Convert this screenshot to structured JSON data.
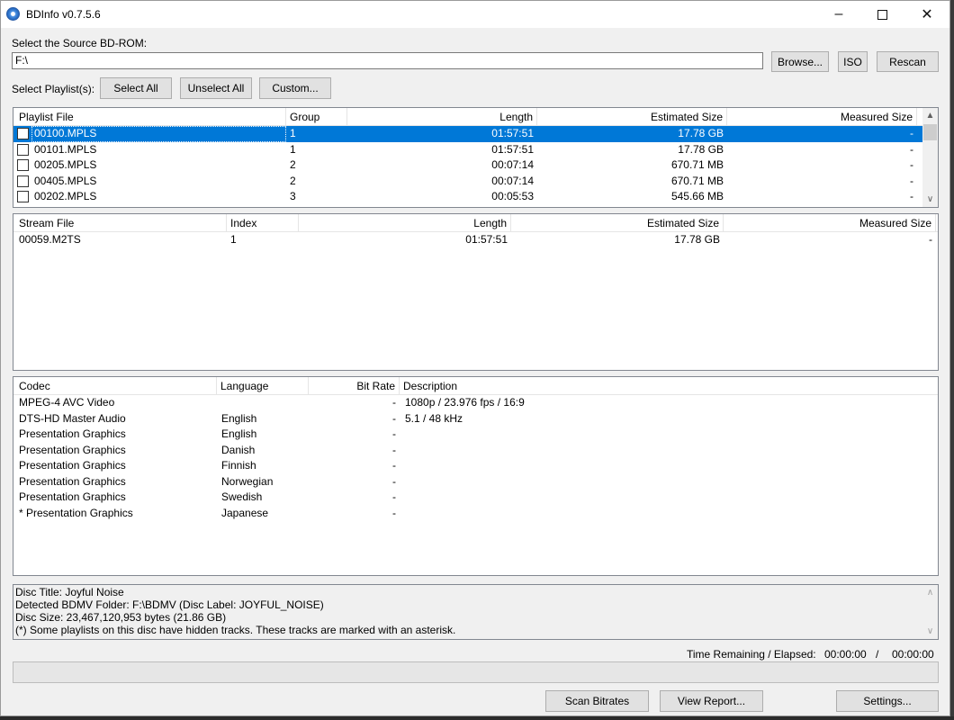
{
  "window": {
    "title": "BDInfo v0.7.5.6"
  },
  "source": {
    "label": "Select the Source BD-ROM:",
    "path": "F:\\",
    "browse_label": "Browse...",
    "iso_label": "ISO",
    "rescan_label": "Rescan"
  },
  "playlist_controls": {
    "label": "Select Playlist(s):",
    "select_all": "Select All",
    "unselect_all": "Unselect All",
    "custom": "Custom..."
  },
  "playlists": {
    "columns": [
      "Playlist File",
      "Group",
      "Length",
      "Estimated Size",
      "Measured Size"
    ],
    "rows": [
      {
        "file": "00100.MPLS",
        "group": "1",
        "length": "01:57:51",
        "est": "17.78 GB",
        "meas": "-"
      },
      {
        "file": "00101.MPLS",
        "group": "1",
        "length": "01:57:51",
        "est": "17.78 GB",
        "meas": "-"
      },
      {
        "file": "00205.MPLS",
        "group": "2",
        "length": "00:07:14",
        "est": "670.71 MB",
        "meas": "-"
      },
      {
        "file": "00405.MPLS",
        "group": "2",
        "length": "00:07:14",
        "est": "670.71 MB",
        "meas": "-"
      },
      {
        "file": "00202.MPLS",
        "group": "3",
        "length": "00:05:53",
        "est": "545.66 MB",
        "meas": "-"
      }
    ]
  },
  "streams": {
    "columns": [
      "Stream File",
      "Index",
      "Length",
      "Estimated Size",
      "Measured Size"
    ],
    "rows": [
      {
        "file": "00059.M2TS",
        "index": "1",
        "length": "01:57:51",
        "est": "17.78 GB",
        "meas": "-"
      }
    ]
  },
  "codecs": {
    "columns": [
      "Codec",
      "Language",
      "Bit Rate",
      "Description"
    ],
    "rows": [
      {
        "codec": "MPEG-4 AVC Video",
        "lang": "",
        "rate": "-",
        "desc": "1080p / 23.976 fps / 16:9"
      },
      {
        "codec": "DTS-HD Master Audio",
        "lang": "English",
        "rate": "-",
        "desc": "5.1 / 48 kHz"
      },
      {
        "codec": "Presentation Graphics",
        "lang": "English",
        "rate": "-",
        "desc": ""
      },
      {
        "codec": "Presentation Graphics",
        "lang": "Danish",
        "rate": "-",
        "desc": ""
      },
      {
        "codec": "Presentation Graphics",
        "lang": "Finnish",
        "rate": "-",
        "desc": ""
      },
      {
        "codec": "Presentation Graphics",
        "lang": "Norwegian",
        "rate": "-",
        "desc": ""
      },
      {
        "codec": "Presentation Graphics",
        "lang": "Swedish",
        "rate": "-",
        "desc": ""
      },
      {
        "codec": "* Presentation Graphics",
        "lang": "Japanese",
        "rate": "-",
        "desc": ""
      }
    ]
  },
  "disc_info": {
    "lines": [
      "Disc Title: Joyful Noise",
      "Detected BDMV Folder: F:\\BDMV (Disc Label: JOYFUL_NOISE)",
      "Disc Size: 23,467,120,953 bytes (21.86 GB)",
      "(*) Some playlists on this disc have hidden tracks. These tracks are marked with an asterisk."
    ]
  },
  "status": {
    "time_label": "Time Remaining / Elapsed:",
    "remaining": "00:00:00",
    "separator": "/",
    "elapsed": "00:00:00",
    "progress": 0
  },
  "footer": {
    "scan_bitrates": "Scan Bitrates",
    "view_report": "View Report...",
    "settings": "Settings..."
  },
  "icons": {
    "app": "disc-icon",
    "minimize": "minimize-icon",
    "maximize": "maximize-icon",
    "close": "close-icon"
  },
  "colors": {
    "selection": "#0078d7",
    "window_bg": "#f0f0f0"
  }
}
